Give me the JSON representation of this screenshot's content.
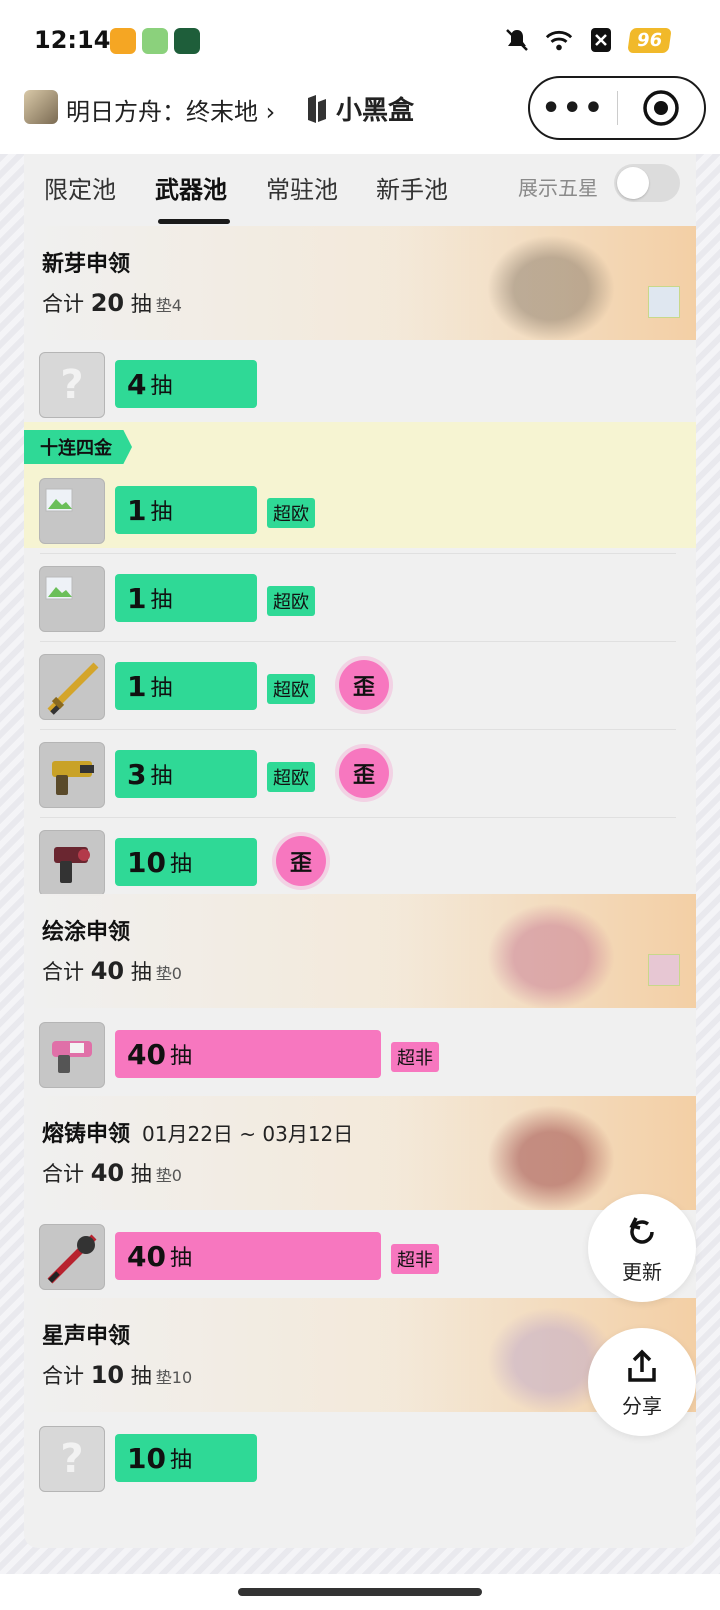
{
  "status_bar": {
    "time": "12:14",
    "battery": "96"
  },
  "nav": {
    "game_name": "明日方舟：终末地 ›",
    "brand": "小黑盒",
    "more_label": "•••"
  },
  "tabs": {
    "items": [
      "限定池",
      "武器池",
      "常驻池",
      "新手池"
    ],
    "active": "武器池",
    "show_five_star_label": "展示五星",
    "show_five_star_enabled": false
  },
  "pools": [
    {
      "name": "新芽申领",
      "date": "",
      "total_prefix": "合计",
      "total": "20",
      "total_unit": "抽",
      "pad": "垫4",
      "rows": [
        {
          "count": "4",
          "unit": "抽",
          "color": "green",
          "thumb": "unknown",
          "tags": []
        }
      ]
    },
    {
      "section_label": "十连四金",
      "rows": [
        {
          "count": "1",
          "unit": "抽",
          "color": "green",
          "thumb": "image",
          "tags": [
            "超欧"
          ]
        },
        {
          "count": "1",
          "unit": "抽",
          "color": "green",
          "thumb": "image",
          "tags": [
            "超欧"
          ]
        },
        {
          "count": "1",
          "unit": "抽",
          "color": "green",
          "thumb": "sword",
          "tags": [
            "超欧"
          ],
          "off_banner": "歪"
        },
        {
          "count": "3",
          "unit": "抽",
          "color": "green",
          "thumb": "gun",
          "tags": [
            "超欧"
          ],
          "off_banner": "歪"
        },
        {
          "count": "10",
          "unit": "抽",
          "color": "green",
          "thumb": "gun",
          "tags": [],
          "off_banner": "歪"
        }
      ]
    },
    {
      "name": "绘涂申领",
      "date": "",
      "total_prefix": "合计",
      "total": "40",
      "total_unit": "抽",
      "pad": "垫0",
      "rows": [
        {
          "count": "40",
          "unit": "抽",
          "color": "pink",
          "thumb": "gun",
          "tags": [
            "超非"
          ]
        }
      ]
    },
    {
      "name": "熔铸申领",
      "date": "01月22日 ~ 03月12日",
      "total_prefix": "合计",
      "total": "40",
      "total_unit": "抽",
      "pad": "垫0",
      "rows": [
        {
          "count": "40",
          "unit": "抽",
          "color": "pink",
          "thumb": "sword",
          "tags": [
            "超非"
          ]
        }
      ]
    },
    {
      "name": "星声申领",
      "date": "",
      "total_prefix": "合计",
      "total": "10",
      "total_unit": "抽",
      "pad": "垫10",
      "rows": [
        {
          "count": "10",
          "unit": "抽",
          "color": "green",
          "thumb": "unknown",
          "tags": []
        }
      ]
    }
  ],
  "fab": {
    "refresh_label": "更新",
    "share_label": "分享"
  },
  "colors": {
    "green": "#2fd996",
    "pink": "#f777bf",
    "wai": "#f777bf"
  }
}
